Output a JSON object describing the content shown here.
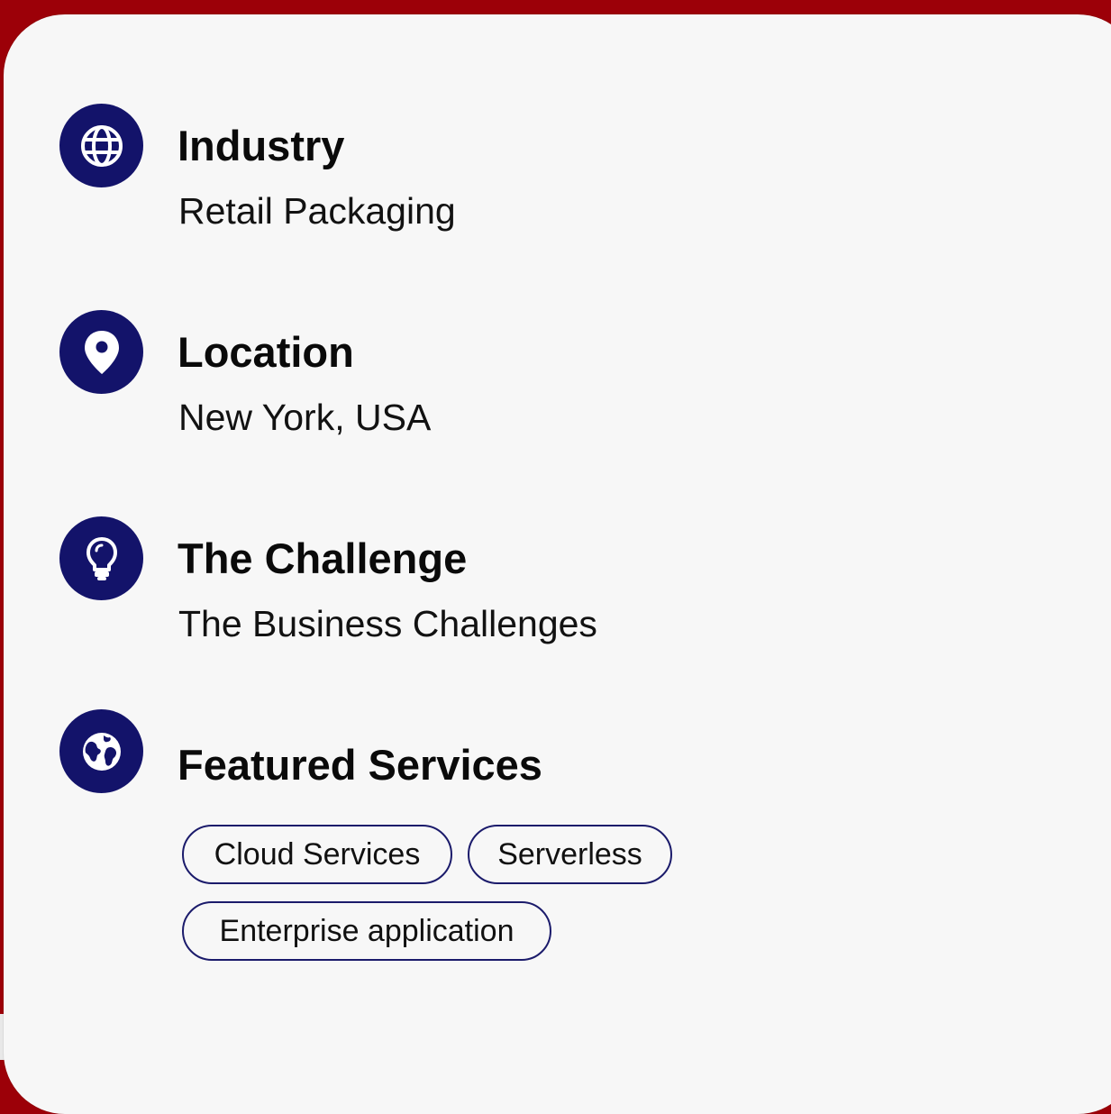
{
  "details": [
    {
      "heading": "Industry",
      "value": "Retail Packaging",
      "icon": "globe-icon"
    },
    {
      "heading": "Location",
      "value": "New York, USA",
      "icon": "map-pin-icon"
    },
    {
      "heading": "The Challenge",
      "value": "The Business Challenges",
      "icon": "lightbulb-icon"
    }
  ],
  "featured": {
    "heading": "Featured Services",
    "icon": "earth-icon",
    "tags": [
      "Cloud Services",
      "Serverless",
      "Enterprise application"
    ]
  },
  "colors": {
    "background": "#9c0008",
    "card": "#f7f7f7",
    "icon_circle": "#13136a",
    "tag_border": "#1b1b6b"
  }
}
